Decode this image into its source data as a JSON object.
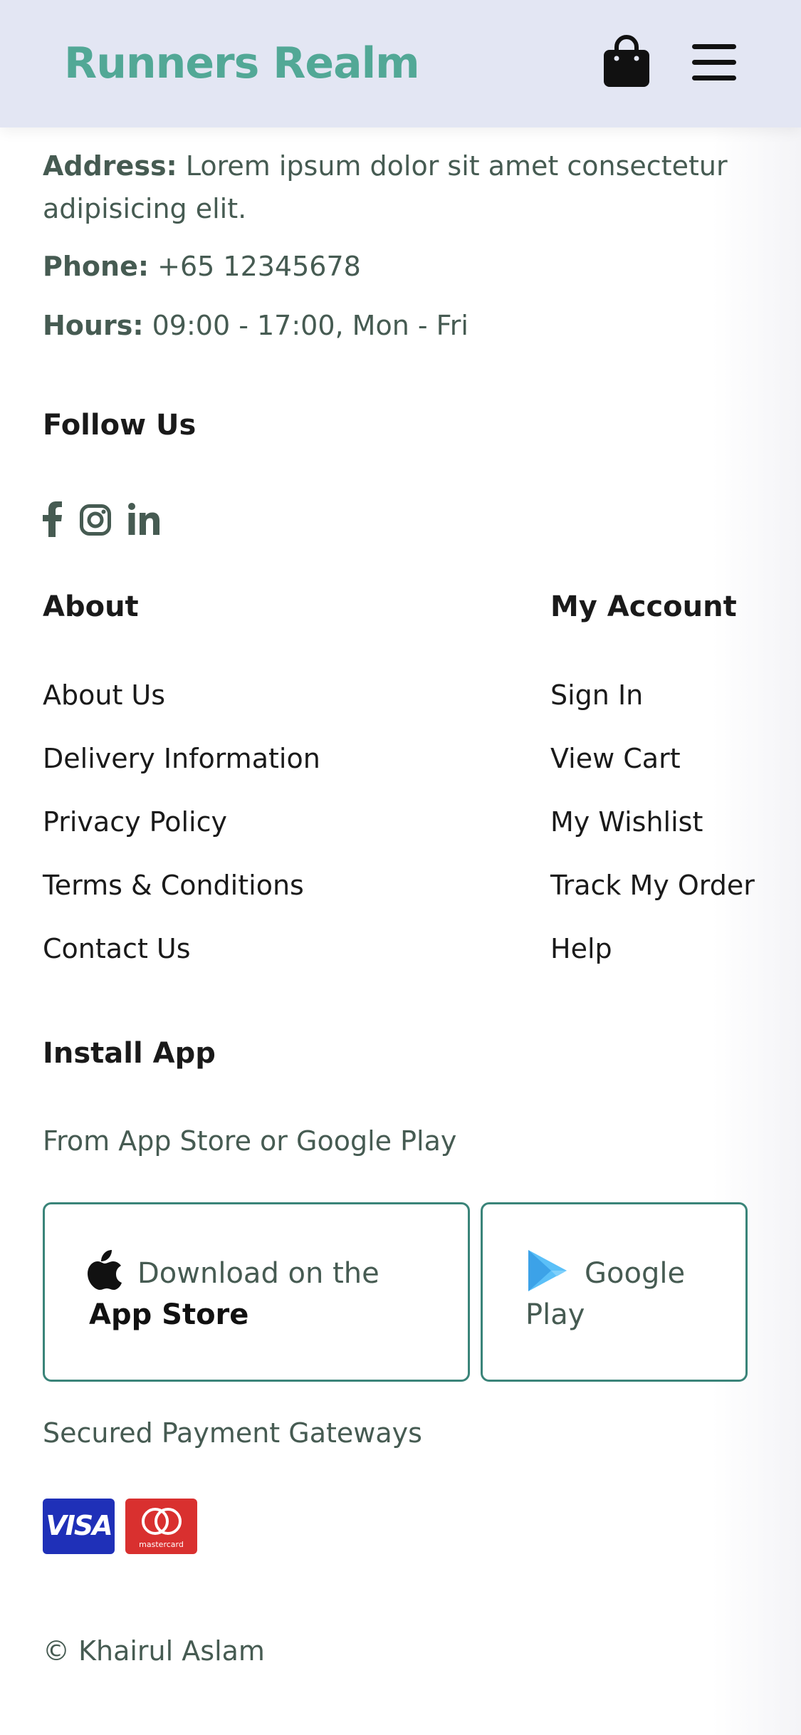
{
  "header": {
    "brand": "Runners Realm",
    "icons": [
      "shopping-bag-icon",
      "hamburger-menu-icon"
    ]
  },
  "contact": {
    "address_label": "Address:",
    "address_value": "Lorem ipsum dolor sit amet consectetur adipisicing elit.",
    "phone_label": "Phone:",
    "phone_value": "+65 12345678",
    "hours_label": "Hours:",
    "hours_value": "09:00 - 17:00, Mon - Fri"
  },
  "follow": {
    "title": "Follow Us",
    "icons": [
      "facebook-icon",
      "instagram-icon",
      "linkedin-icon"
    ]
  },
  "about": {
    "title": "About",
    "links": [
      "About Us",
      "Delivery Information",
      "Privacy Policy",
      "Terms & Conditions",
      "Contact Us"
    ]
  },
  "account": {
    "title": "My Account",
    "links": [
      "Sign In",
      "View Cart",
      "My Wishlist",
      "Track My Order",
      "Help"
    ]
  },
  "install": {
    "title": "Install App",
    "subtitle": "From App Store or Google Play",
    "app_store": {
      "line1": "Download on the",
      "line2": "App Store"
    },
    "google_play": {
      "line1": "Google",
      "line2": "Play"
    }
  },
  "payments": {
    "title": "Secured Payment Gateways",
    "visa": "VISA",
    "mastercard": "mastercard"
  },
  "footer": {
    "copyright": "© Khairul Aslam"
  },
  "colors": {
    "brand": "#52a896",
    "header_bg": "#e3e6f3",
    "text": "#465b52",
    "heading": "#1a1a1a",
    "button_border": "#3a8479",
    "visa_blue": "#1f30b8",
    "mastercard_red": "#d9302f"
  }
}
